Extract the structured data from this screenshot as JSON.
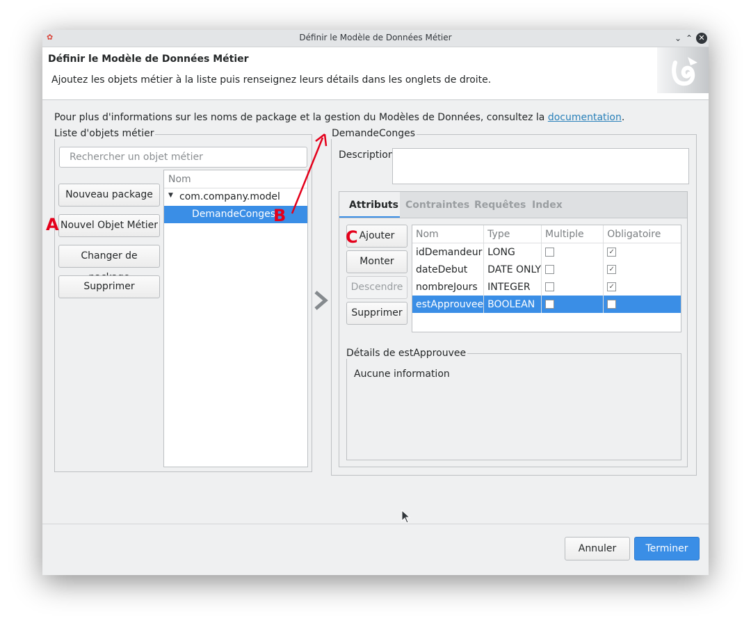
{
  "window": {
    "title": "Définir le Modèle de Données Métier"
  },
  "header": {
    "title": "Définir le Modèle de Données Métier",
    "subtitle": "Ajoutez les objets métier à la liste puis renseignez leurs détails dans les onglets de droite."
  },
  "info": {
    "text": "Pour plus d'informations sur les noms de package et la gestion du Modèles de Données, consultez la ",
    "link": "documentation",
    "suffix": "."
  },
  "left_panel": {
    "legend": "Liste d'objets métier",
    "search_placeholder": "Rechercher un objet métier",
    "buttons": {
      "new_package": "Nouveau package",
      "new_object": "Nouvel Objet Métier",
      "change_package": "Changer de package",
      "delete": "Supprimer"
    },
    "tree": {
      "header": "Nom",
      "package": "com.company.model",
      "object": "DemandeConges"
    }
  },
  "right_panel": {
    "legend": "DemandeConges",
    "description_label": "Description",
    "tabs": [
      "Attributs",
      "Contraintes",
      "Requêtes",
      "Index"
    ],
    "buttons": {
      "add": "Ajouter",
      "up": "Monter",
      "down": "Descendre",
      "delete": "Supprimer"
    },
    "table": {
      "headers": [
        "Nom",
        "Type",
        "Multiple",
        "Obligatoire"
      ],
      "rows": [
        {
          "name": "idDemandeur",
          "type": "LONG",
          "multiple": false,
          "mandatory": true
        },
        {
          "name": "dateDebut",
          "type": "DATE ONLY",
          "multiple": false,
          "mandatory": true
        },
        {
          "name": "nombreJours",
          "type": "INTEGER",
          "multiple": false,
          "mandatory": true
        },
        {
          "name": "estApprouvee",
          "type": "BOOLEAN",
          "multiple": false,
          "mandatory": false
        }
      ]
    },
    "details_legend": "Détails de estApprouvee",
    "details_text": "Aucune information"
  },
  "footer": {
    "cancel": "Annuler",
    "finish": "Terminer"
  },
  "annotations": {
    "a": "A",
    "b": "B",
    "c": "C"
  }
}
